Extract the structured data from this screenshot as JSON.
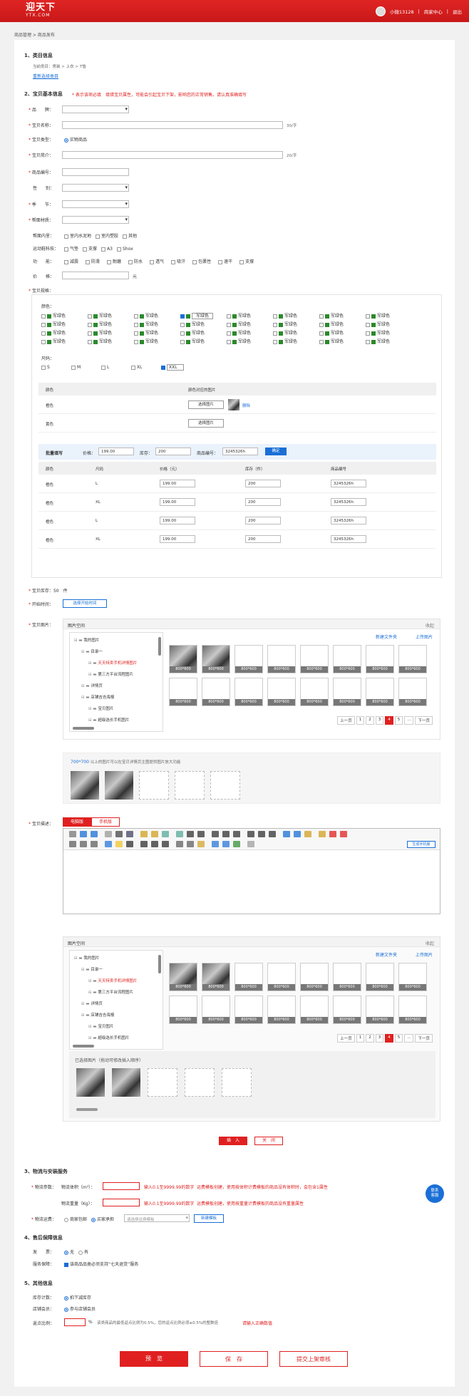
{
  "header": {
    "logo": "迎天下",
    "logo_sub": "YTX.COM",
    "user": "小微13128",
    "seller_center": "商家中心",
    "logout": "退出"
  },
  "breadcrumb": {
    "a": "商品管理",
    "b": "商品发布"
  },
  "s1": {
    "title": "1、类目信息",
    "current": "当前类目：男装 > 上衣 > T恤",
    "reselect": "重新选择类目"
  },
  "s2": {
    "title": "2、宝贝基本信息",
    "hint1": "* 表示该项必填",
    "hint2": "填错宝贝属性，可能会引起宝贝下架，影响您的正常销售。请认真准确填写",
    "brand": "品　　牌：",
    "name": "宝贝名称：",
    "limit30": "30/字",
    "type": "宝贝类型：",
    "type_val": "实物商品",
    "intro": "宝贝简介：",
    "limit20": "20/字",
    "code": "商品编号：",
    "gender": "性　　别：",
    "season": "季　　节：",
    "material": "帮面材质：",
    "inner": "帮面内里：",
    "inner_opts": [
      "室内水泥地",
      "室内塑胶",
      "其他"
    ],
    "sport": "运动鞋科技：",
    "sport_opts": [
      "气垫",
      "支撑",
      "A3",
      "Shox"
    ],
    "func": "功　　能：",
    "func_opts": [
      "减震",
      "防滑",
      "耐磨",
      "防水",
      "透气",
      "吸汗",
      "包裹性",
      "速干",
      "支撑"
    ],
    "price": "价　　格：",
    "price_unit": "元",
    "spec": "宝贝规格：",
    "color_title": "颜色：",
    "color_label": "军绿色",
    "size_title": "尺码：",
    "sizes": [
      "S",
      "M",
      "L",
      "XL",
      "XXL"
    ],
    "ctable": {
      "h1": "颜色",
      "h2": "颜色对应的图片",
      "rows": [
        {
          "c": "橙色",
          "btn": "选择图片",
          "del": "删除"
        },
        {
          "c": "黄色",
          "btn": "选择图片"
        }
      ]
    },
    "batch": {
      "label": "批量填写",
      "price_l": "价格：",
      "price": "199.00",
      "stock_l": "库存：",
      "stock": "200",
      "code_l": "商品编号：",
      "code": "3245326h",
      "ok": "确定"
    },
    "stable": {
      "h": [
        "颜色",
        "尺码",
        "价格（元）",
        "库存（件）",
        "商品编号"
      ],
      "rows": [
        [
          "橙色",
          "L",
          "199.00",
          "200",
          "3245326h"
        ],
        [
          "橙色",
          "XL",
          "199.00",
          "200",
          "3245326h"
        ],
        [
          "橙色",
          "L",
          "199.00",
          "200",
          "3245326h"
        ],
        [
          "橙色",
          "XL",
          "199.00",
          "200",
          "3245326h"
        ]
      ]
    },
    "stock_l": "宝贝库存：",
    "stock_v": "50　件",
    "timing": "开始时间：",
    "timing_btn": "选择开始时间",
    "pics": "宝贝图片："
  },
  "gallery": {
    "title": "图片空间",
    "collapse": "收起",
    "newfolder": "新建文件夹",
    "upload": "上传图片",
    "tree": [
      "我的图片",
      "目录一",
      "天天特卖手机详情图片",
      "第三方平台流程图片",
      "详情页",
      "店铺吉吉海报",
      "宝贝图片",
      "超级选长手机图片"
    ],
    "cap": "800*600",
    "pages": [
      "上一页",
      "1",
      "2",
      "3",
      "4",
      "5",
      "...",
      "下一页"
    ],
    "tip_hl": "700*700",
    "tip": "以上的图片可以在宝贝详情页主图提供图片放大功能"
  },
  "desc": {
    "label": "宝贝描述：",
    "tab_pc": "电脑版",
    "tab_m": "手机版",
    "gen": "生成手机版",
    "selected": "已选择图片（拖动可修改插入顺序）",
    "insert": "插　入",
    "close": "关　闭"
  },
  "s3": {
    "title": "3、物流与安装服务",
    "vol": "物流体积（m³）：",
    "vol_tip": "输入0.1至9999.99的数字",
    "vol_tip2": "运费模板创建，使用按体积计费模板的商品没有体积时，会包含1属性",
    "wt": "物流重量（Kg）：",
    "wt_tip": "输入0.1至9999.99的数字",
    "wt_tip2": "运费模板创建，使用按重量计费模板的商品没有重量属性",
    "logi": "物流参数：",
    "logi_cost": "物流运费：",
    "opt1": "商家包邮",
    "opt2": "买家承担",
    "tpl_ph": "请选择运费模板",
    "new_tpl": "新建模板"
  },
  "s4": {
    "title": "4、售后保障信息",
    "inv": "发　　票：",
    "no": "无",
    "yes": "有",
    "service": "服务保障：",
    "service_txt": "该商品品类必须支持“七天退货”服务"
  },
  "s5": {
    "title": "5、其他信息",
    "stock_count": "库存计数：",
    "stock_opt": "拍下减库存",
    "member": "店铺会员：",
    "member_opt": "参与店铺会员",
    "rebate": "返点比例：",
    "rebate_tip": "该类商品的最低返点比例为0.5%，您的返点比例必须≥0.5%的整数倍",
    "rebate_red": "请输入正确数值"
  },
  "actions": {
    "preview": "预　览",
    "save": "保　存",
    "submit": "提交上架审核"
  },
  "float": {
    "a": "联系",
    "b": "客服"
  }
}
